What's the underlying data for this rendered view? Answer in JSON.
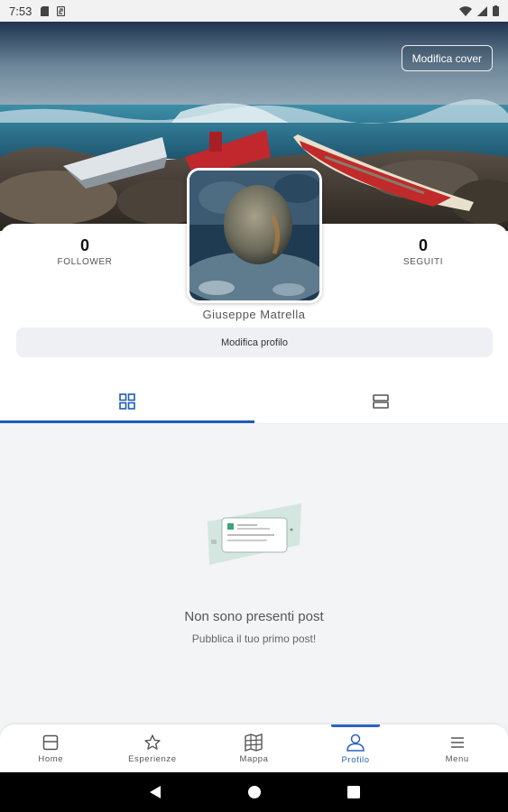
{
  "status_bar": {
    "time": "7:53"
  },
  "cover": {
    "edit_button_label": "Modifica cover"
  },
  "profile": {
    "followers": {
      "count": "0",
      "label": "FOLLOWER"
    },
    "following": {
      "count": "0",
      "label": "SEGUITI"
    },
    "name": "Giuseppe Matrella",
    "edit_profile_label": "Modifica profilo"
  },
  "tabs": [
    {
      "icon": "grid-icon",
      "active": true
    },
    {
      "icon": "list-icon",
      "active": false
    }
  ],
  "empty_state": {
    "title": "Non sono presenti post",
    "subtitle": "Pubblica il tuo primo post!"
  },
  "bottom_nav": [
    {
      "label": "Home",
      "icon": "home-icon",
      "active": false
    },
    {
      "label": "Esperienze",
      "icon": "star-icon",
      "active": false
    },
    {
      "label": "Mappa",
      "icon": "map-icon",
      "active": false
    },
    {
      "label": "Profilo",
      "icon": "profile-icon",
      "active": true
    },
    {
      "label": "Menu",
      "icon": "menu-icon",
      "active": false
    }
  ],
  "colors": {
    "accent": "#1e5cb3",
    "nav_active": "#2d62c0"
  }
}
